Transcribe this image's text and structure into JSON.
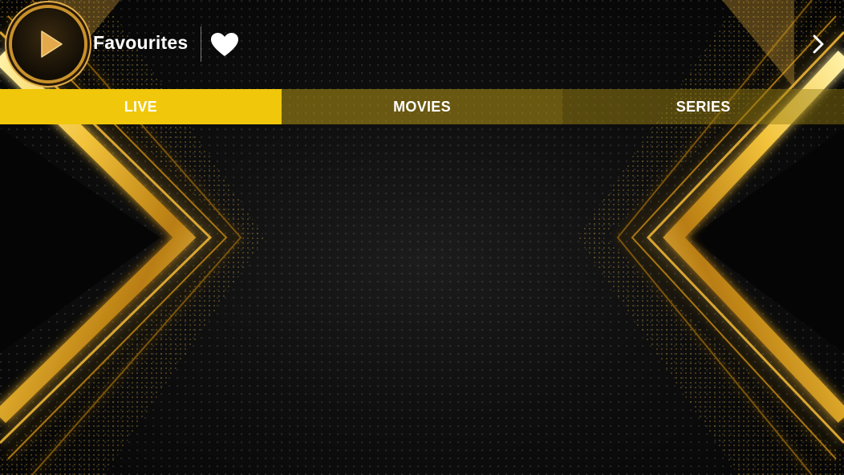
{
  "header": {
    "title": "Favourites",
    "logo_icon": "play-icon",
    "favourite_icon": "heart-icon",
    "next_icon": "chevron-right-icon"
  },
  "tabs": [
    {
      "label": "LIVE",
      "active": true
    },
    {
      "label": "MOVIES",
      "active": false
    },
    {
      "label": "SERIES",
      "active": false
    }
  ],
  "colors": {
    "accent": "#f0c70a",
    "gold": "#d9a630",
    "background": "#0b0b0b",
    "text": "#ffffff"
  }
}
